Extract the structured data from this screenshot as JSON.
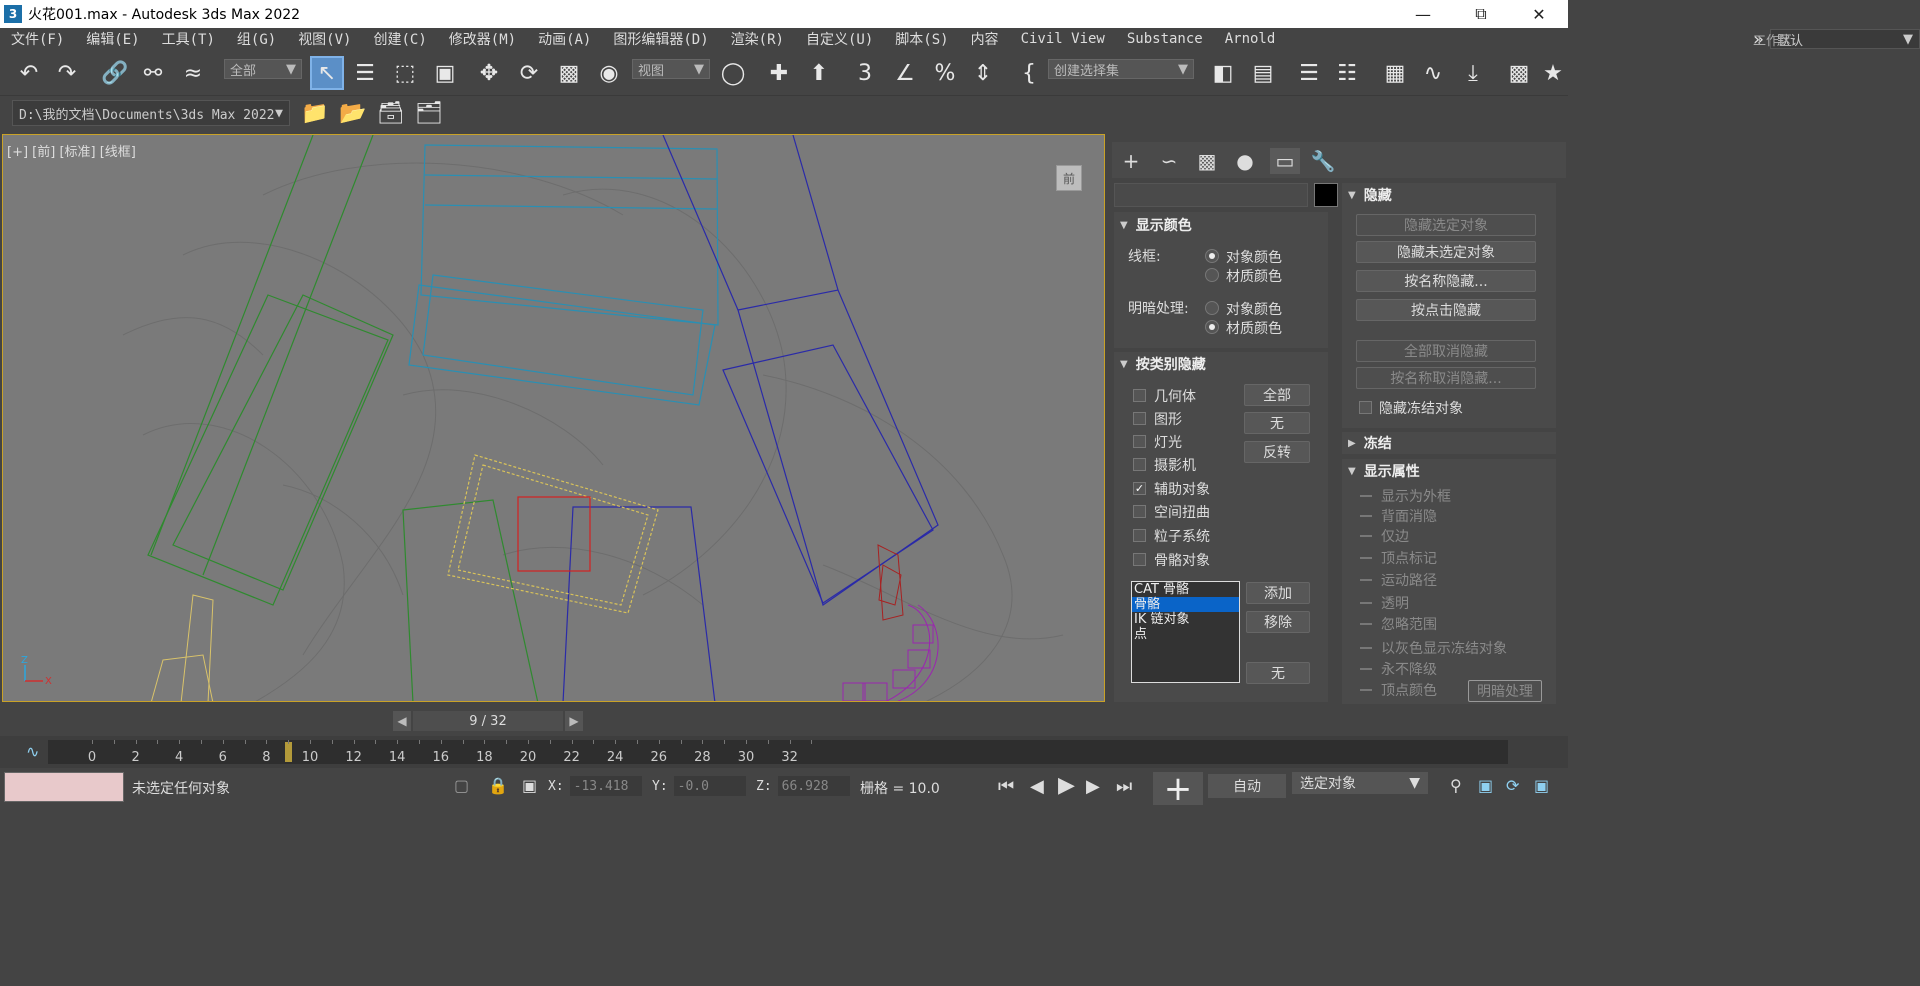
{
  "window": {
    "title": "火花001.max - Autodesk 3ds Max 2022",
    "app_icon": "3"
  },
  "menu": [
    "文件(F)",
    "编辑(E)",
    "工具(T)",
    "组(G)",
    "视图(V)",
    "创建(C)",
    "修改器(M)",
    "动画(A)",
    "图形编辑器(D)",
    "渲染(R)",
    "自定义(U)",
    "脚本(S)",
    "内容",
    "Civil View",
    "Substance",
    "Arnold"
  ],
  "workspace": {
    "label": "工作区:",
    "value": "默认",
    "more": "»"
  },
  "toolbar": {
    "filter": "全部",
    "ref_coord": "视图",
    "selection_set": "创建选择集"
  },
  "project_path": "D:\\我的文档\\Documents\\3ds Max 2022",
  "viewport": {
    "label": "[+] [前] [标准] [线框]",
    "cube_label": "前"
  },
  "panel": {
    "display_color": {
      "header": "显示颜色",
      "wire_label": "线框:",
      "shaded_label": "明暗处理:",
      "wire_options": [
        "对象颜色",
        "材质颜色"
      ],
      "wire_selected": 0,
      "shaded_options": [
        "对象颜色",
        "材质颜色"
      ],
      "shaded_selected": 1
    },
    "hide_by_category": {
      "header": "按类别隐藏",
      "items": [
        {
          "label": "几何体",
          "checked": false
        },
        {
          "label": "图形",
          "checked": false
        },
        {
          "label": "灯光",
          "checked": false
        },
        {
          "label": "摄影机",
          "checked": false
        },
        {
          "label": "辅助对象",
          "checked": true
        },
        {
          "label": "空间扭曲",
          "checked": false
        },
        {
          "label": "粒子系统",
          "checked": false
        },
        {
          "label": "骨骼对象",
          "checked": false
        }
      ],
      "btn_all": "全部",
      "btn_none": "无",
      "btn_invert": "反转",
      "list": [
        "CAT 骨骼",
        "骨骼",
        "IK 链对象",
        "点"
      ],
      "list_selected": 1,
      "btn_add": "添加",
      "btn_remove": "移除",
      "btn_none2": "无"
    },
    "hide": {
      "header": "隐藏",
      "buttons": [
        {
          "label": "隐藏选定对象",
          "disabled": true
        },
        {
          "label": "隐藏未选定对象",
          "disabled": false
        },
        {
          "label": "按名称隐藏...",
          "disabled": false
        },
        {
          "label": "按点击隐藏",
          "disabled": false
        },
        {
          "label": "全部取消隐藏",
          "disabled": true
        },
        {
          "label": "按名称取消隐藏...",
          "disabled": true
        }
      ],
      "hide_frozen": "隐藏冻结对象"
    },
    "freeze": {
      "header": "冻结"
    },
    "display_props": {
      "header": "显示属性",
      "items": [
        "显示为外框",
        "背面消隐",
        "仅边",
        "顶点标记",
        "运动路径",
        "透明",
        "忽略范围",
        "以灰色显示冻结对象",
        "永不降级",
        "顶点颜色"
      ],
      "shade_btn": "明暗处理"
    }
  },
  "time": {
    "frame_display": "9 / 32",
    "current_frame": 9,
    "ticks": [
      "0",
      "2",
      "4",
      "6",
      "8",
      "10",
      "12",
      "14",
      "16",
      "18",
      "20",
      "22",
      "24",
      "26",
      "28",
      "30",
      "32"
    ]
  },
  "status": {
    "message": "未选定任何对象",
    "x_label": "X:",
    "x": "-13.418",
    "y_label": "Y:",
    "y": "-0.0",
    "z_label": "Z:",
    "z": "66.928",
    "grid": "栅格 = 10.0",
    "auto_key": "自动",
    "key_filter": "选定对象"
  }
}
